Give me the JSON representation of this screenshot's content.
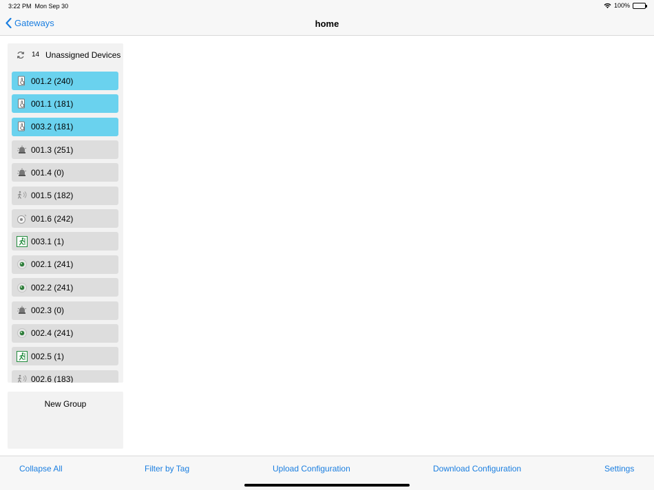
{
  "status_bar": {
    "time": "3:22 PM",
    "date": "Mon Sep 30",
    "battery": "100%"
  },
  "nav": {
    "back_label": "Gateways",
    "title": "home"
  },
  "group": {
    "count": "14",
    "title": "Unassigned Devices",
    "devices": [
      {
        "label": "001.2 (240)",
        "icon": "tablet-touch-icon",
        "selected": true
      },
      {
        "label": "001.1 (181)",
        "icon": "tablet-touch-icon",
        "selected": true
      },
      {
        "label": "003.2 (181)",
        "icon": "tablet-touch-icon",
        "selected": true
      },
      {
        "label": "001.3 (251)",
        "icon": "siren-icon",
        "selected": false
      },
      {
        "label": "001.4 (0)",
        "icon": "siren-icon",
        "selected": false
      },
      {
        "label": "001.5 (182)",
        "icon": "motion-sensor-icon",
        "selected": false
      },
      {
        "label": "001.6 (242)",
        "icon": "smoke-detector-icon",
        "selected": false
      },
      {
        "label": "003.1 (1)",
        "icon": "exit-sign-icon",
        "selected": false
      },
      {
        "label": "002.1 (241)",
        "icon": "light-fixture-icon",
        "selected": false
      },
      {
        "label": "002.2 (241)",
        "icon": "light-fixture-icon",
        "selected": false
      },
      {
        "label": "002.3 (0)",
        "icon": "siren-icon",
        "selected": false
      },
      {
        "label": "002.4 (241)",
        "icon": "light-fixture-icon",
        "selected": false
      },
      {
        "label": "002.5 (1)",
        "icon": "exit-sign-icon",
        "selected": false
      },
      {
        "label": "002.6 (183)",
        "icon": "motion-sensor-icon",
        "selected": false
      }
    ]
  },
  "new_group": {
    "label": "New Group"
  },
  "toolbar": {
    "collapse_all": "Collapse All",
    "filter_by_tag": "Filter by Tag",
    "upload_configuration": "Upload Configuration",
    "download_configuration": "Download Configuration",
    "settings": "Settings"
  },
  "colors": {
    "accent": "#1a7ee0",
    "selected": "#6ad2ee",
    "item_bg": "#dddddd",
    "panel_bg": "#f2f2f2",
    "exit_green": "#1f8a3b"
  }
}
